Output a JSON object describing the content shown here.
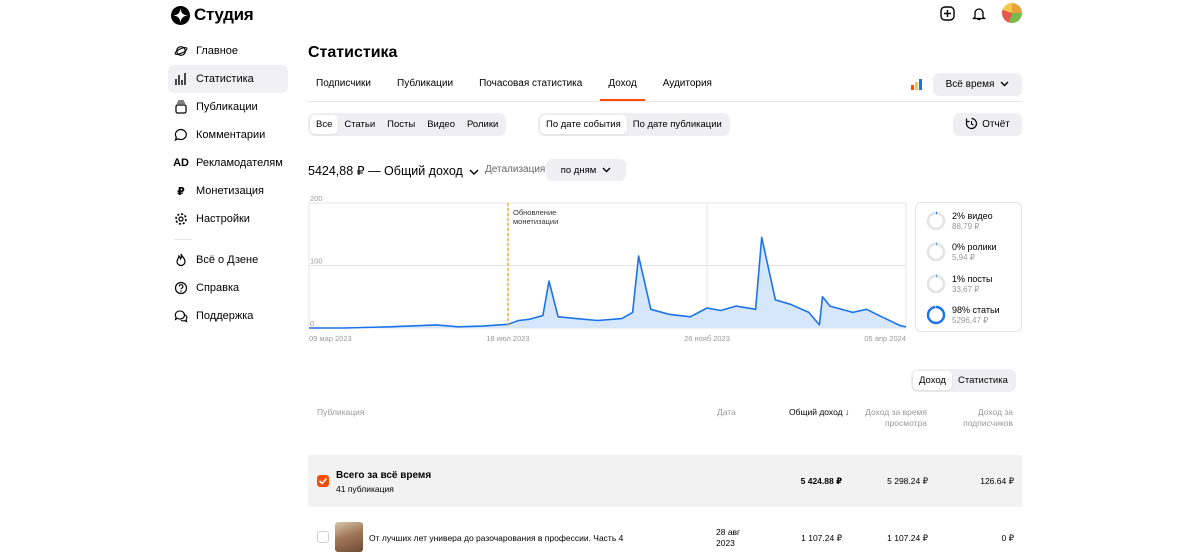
{
  "app": {
    "title": "Студия"
  },
  "sidebar": {
    "items": [
      {
        "label": "Главное",
        "icon": "planet-icon"
      },
      {
        "label": "Статистика",
        "icon": "bar-chart-icon",
        "active": true
      },
      {
        "label": "Публикации",
        "icon": "stack-icon"
      },
      {
        "label": "Комментарии",
        "icon": "comment-icon"
      },
      {
        "label": "Рекламодателям",
        "icon": "ad-icon"
      },
      {
        "label": "Монетизация",
        "icon": "ruble-icon"
      },
      {
        "label": "Настройки",
        "icon": "gear-icon"
      }
    ],
    "secondary": [
      {
        "label": "Всё о Дзене",
        "icon": "flame-icon"
      },
      {
        "label": "Справка",
        "icon": "help-icon"
      },
      {
        "label": "Поддержка",
        "icon": "support-icon"
      }
    ]
  },
  "page": {
    "title": "Статистика"
  },
  "tabs": [
    "Подписчики",
    "Публикации",
    "Почасовая статистика",
    "Доход",
    "Аудитория"
  ],
  "active_tab": "Доход",
  "period": "Всё время",
  "content_filter": [
    "Все",
    "Статьи",
    "Посты",
    "Видео",
    "Ролики"
  ],
  "date_filter": [
    "По дате события",
    "По дате публикации"
  ],
  "report_label": "Отчёт",
  "total_label": "5424,88 ₽ — Общий доход",
  "detail_label": "Детализация",
  "detail_value": "по дням",
  "accent": "#ff4d00",
  "chart_data": {
    "type": "area",
    "ylim": [
      0,
      200
    ],
    "y_ticks": [
      "200",
      "100",
      "0"
    ],
    "x_ticks": [
      "09 мар 2023",
      "18 июл 2023",
      "26 нояб 2023",
      "05 апр 2024"
    ],
    "annotation": "Обновление монетизации",
    "annotation_date": "18 июл 2023",
    "series": [
      {
        "color": "#1a73e8",
        "x": [
          "09 мар 2023",
          "01 апр 2023",
          "01 май 2023",
          "01 июн 2023",
          "15 июн 2023",
          "01 июл 2023",
          "18 июл 2023",
          "25 июл 2023",
          "01 авг 2023",
          "10 авг 2023",
          "14 авг 2023",
          "20 авг 2023",
          "01 сен 2023",
          "15 сен 2023",
          "01 окт 2023",
          "08 окт 2023",
          "12 окт 2023",
          "20 окт 2023",
          "01 нояб 2023",
          "15 нояб 2023",
          "26 нояб 2023",
          "05 дек 2023",
          "15 дек 2023",
          "28 дек 2023",
          "01 янв 2024",
          "10 янв 2024",
          "20 янв 2024",
          "01 фев 2024",
          "08 фев 2024",
          "10 фев 2024",
          "15 фев 2024",
          "01 мар 2024",
          "10 мар 2024",
          "20 мар 2024",
          "01 апр 2024",
          "05 апр 2024"
        ],
        "y": [
          0,
          0,
          2,
          5,
          2,
          3,
          6,
          12,
          14,
          20,
          75,
          18,
          15,
          12,
          15,
          25,
          115,
          30,
          22,
          18,
          32,
          28,
          35,
          30,
          145,
          45,
          38,
          25,
          5,
          50,
          35,
          25,
          30,
          18,
          4,
          2
        ]
      }
    ]
  },
  "legend": [
    {
      "pct": "2% видео",
      "amount": "88,79 ₽",
      "fraction": 0.02
    },
    {
      "pct": "0% ролики",
      "amount": "5,94 ₽",
      "fraction": 0.001
    },
    {
      "pct": "1% посты",
      "amount": "33,67 ₽",
      "fraction": 0.01
    },
    {
      "pct": "98% статьи",
      "amount": "5296,47 ₽",
      "fraction": 0.98
    }
  ],
  "table_toggle": [
    "Доход",
    "Статистика"
  ],
  "table": {
    "headers": {
      "publication": "Публикация",
      "date": "Дата",
      "total": "Общий доход ↓",
      "views_income": "Доход за время просмотра",
      "subs_income": "Доход за подписчиков"
    },
    "summary": {
      "title": "Всего за всё время",
      "subtitle": "41 публикация",
      "total": "5 424.88 ₽",
      "views_income": "5 298.24 ₽",
      "subs_income": "126.64 ₽"
    },
    "rows": [
      {
        "title": "От лучших лет универа до разочарования в профессии. Часть 4",
        "date_line1": "28 авг",
        "date_line2": "2023",
        "total": "1 107.24 ₽",
        "views_income": "1 107.24 ₽",
        "subs_income": "0 ₽"
      }
    ]
  }
}
